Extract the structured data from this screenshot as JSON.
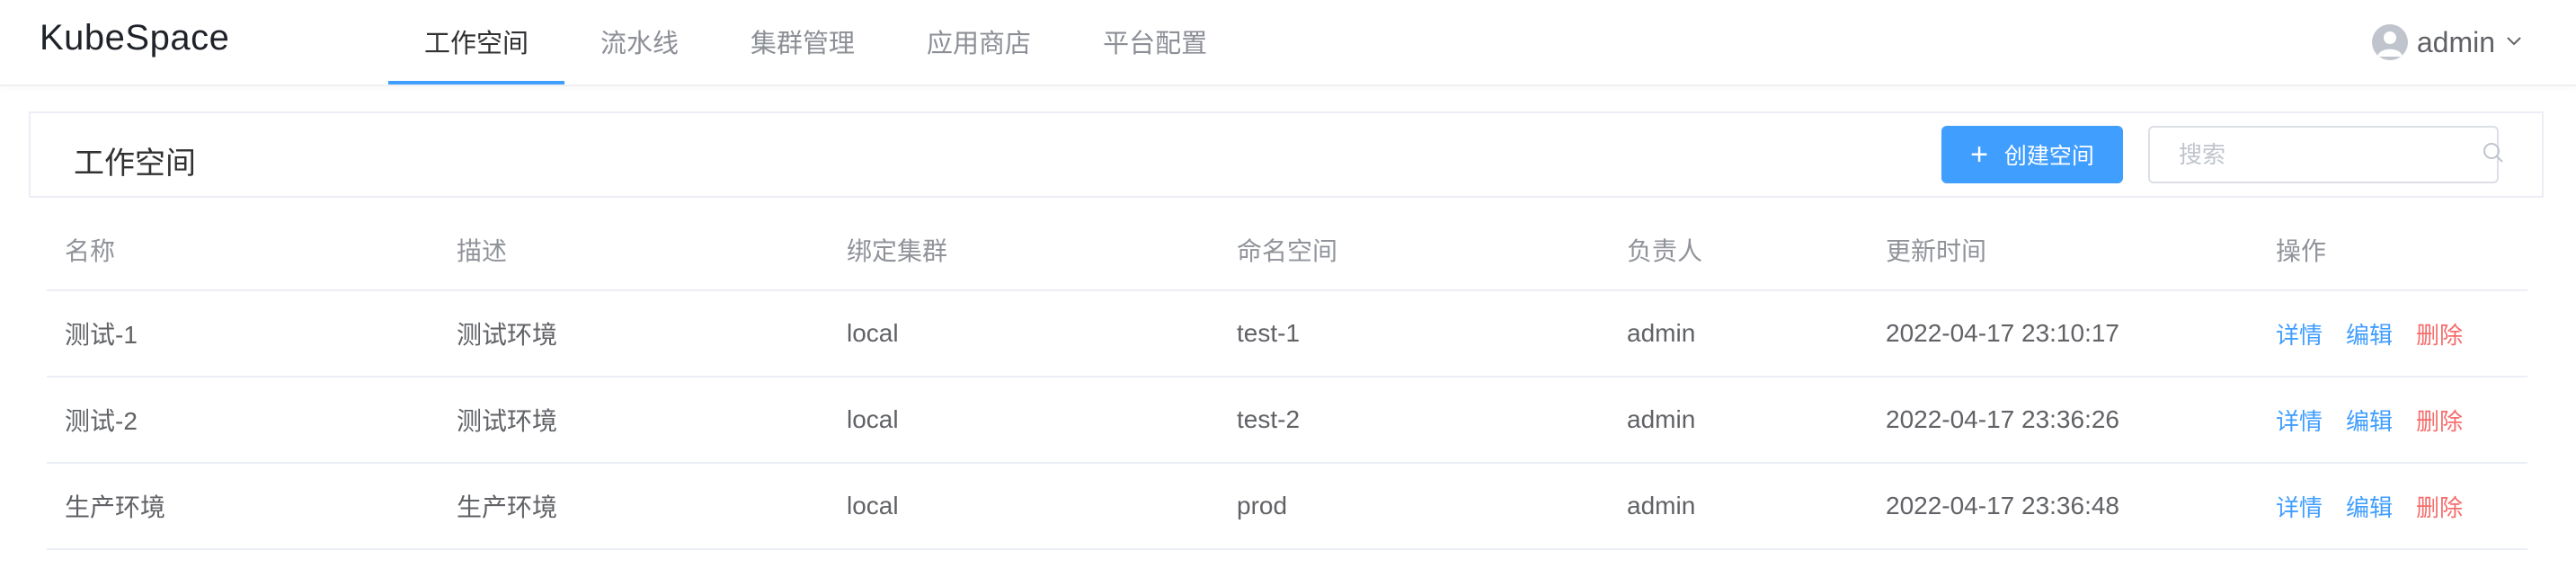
{
  "app": {
    "logo": "KubeSpace"
  },
  "nav": {
    "items": [
      {
        "label": "工作空间",
        "active": true
      },
      {
        "label": "流水线",
        "active": false
      },
      {
        "label": "集群管理",
        "active": false
      },
      {
        "label": "应用商店",
        "active": false
      },
      {
        "label": "平台配置",
        "active": false
      }
    ]
  },
  "user": {
    "name": "admin",
    "avatar_icon": "user-avatar-icon",
    "menu_icon": "chevron-down-icon"
  },
  "header": {
    "title": "工作空间",
    "create_button": "创建空间",
    "search_placeholder": "搜索",
    "search_value": ""
  },
  "table": {
    "columns": [
      "名称",
      "描述",
      "绑定集群",
      "命名空间",
      "负责人",
      "更新时间",
      "操作"
    ],
    "actions": {
      "detail": "详情",
      "edit": "编辑",
      "delete": "删除"
    },
    "rows": [
      {
        "name": "测试-1",
        "description": "测试环境",
        "cluster": "local",
        "namespace": "test-1",
        "owner": "admin",
        "updated": "2022-04-17 23:10:17"
      },
      {
        "name": "测试-2",
        "description": "测试环境",
        "cluster": "local",
        "namespace": "test-2",
        "owner": "admin",
        "updated": "2022-04-17 23:36:26"
      },
      {
        "name": "生产环境",
        "description": "生产环境",
        "cluster": "local",
        "namespace": "prod",
        "owner": "admin",
        "updated": "2022-04-17 23:36:48"
      }
    ]
  },
  "colors": {
    "accent": "#409eff",
    "danger": "#f56c6c",
    "text": "#606266",
    "muted": "#909399"
  }
}
